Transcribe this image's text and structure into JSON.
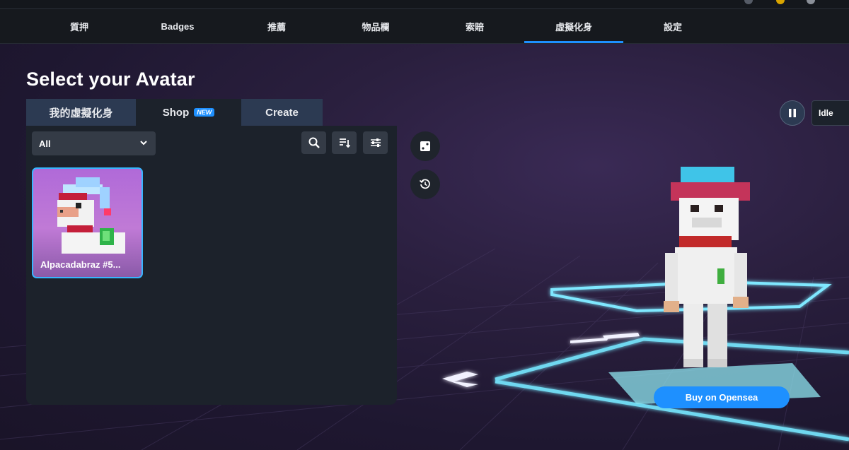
{
  "nav": {
    "tabs": [
      {
        "label": "質押"
      },
      {
        "label": "Badges"
      },
      {
        "label": "推薦"
      },
      {
        "label": "物品欄"
      },
      {
        "label": "索賠"
      },
      {
        "label": "虛擬化身"
      },
      {
        "label": "設定"
      }
    ],
    "active_index": 5
  },
  "page": {
    "title": "Select your Avatar"
  },
  "tabs": {
    "my_avatars": "我的虛擬化身",
    "shop": "Shop",
    "shop_badge": "NEW",
    "create": "Create",
    "active": "Shop"
  },
  "filter": {
    "selected": "All"
  },
  "toolbar": {
    "icons": [
      "search-icon",
      "sort-icon",
      "filter-icon"
    ]
  },
  "items": [
    {
      "name": "Alpacadabraz #5..."
    }
  ],
  "side_controls": {
    "icons": [
      "dice-icon",
      "history-icon"
    ]
  },
  "viewer": {
    "animation": "Idle",
    "buy_label": "Buy on Opensea"
  },
  "colors": {
    "accent": "#1e90ff",
    "panel": "#1c222b",
    "tab": "#2c3a52"
  }
}
